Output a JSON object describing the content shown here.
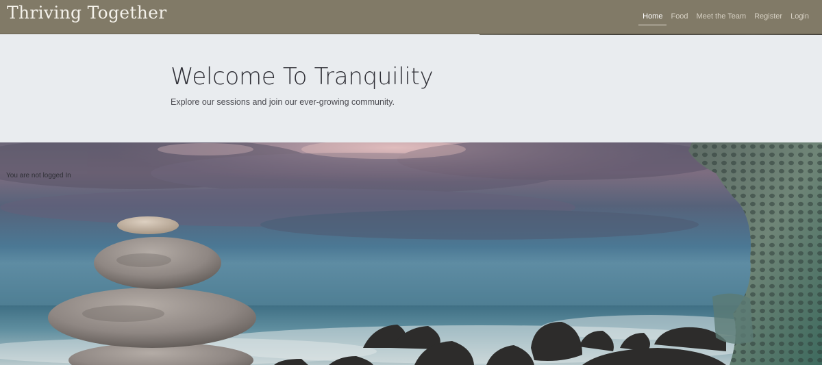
{
  "brand": {
    "name": "Thriving Together"
  },
  "nav": {
    "items": [
      {
        "label": "Home",
        "active": true
      },
      {
        "label": "Food",
        "active": false
      },
      {
        "label": "Meet the Team",
        "active": false
      },
      {
        "label": "Register",
        "active": false
      },
      {
        "label": "Login",
        "active": false
      }
    ]
  },
  "hero": {
    "title": "Welcome To Tranquility",
    "subtitle": "Explore our sessions and join our ever-growing community."
  },
  "status": {
    "login_text": "You are not logged In"
  },
  "colors": {
    "navbar": "#817a67",
    "hero_bg": "#e9ecef",
    "nav_text": "#d7d1c4",
    "nav_active": "#ffffff"
  }
}
